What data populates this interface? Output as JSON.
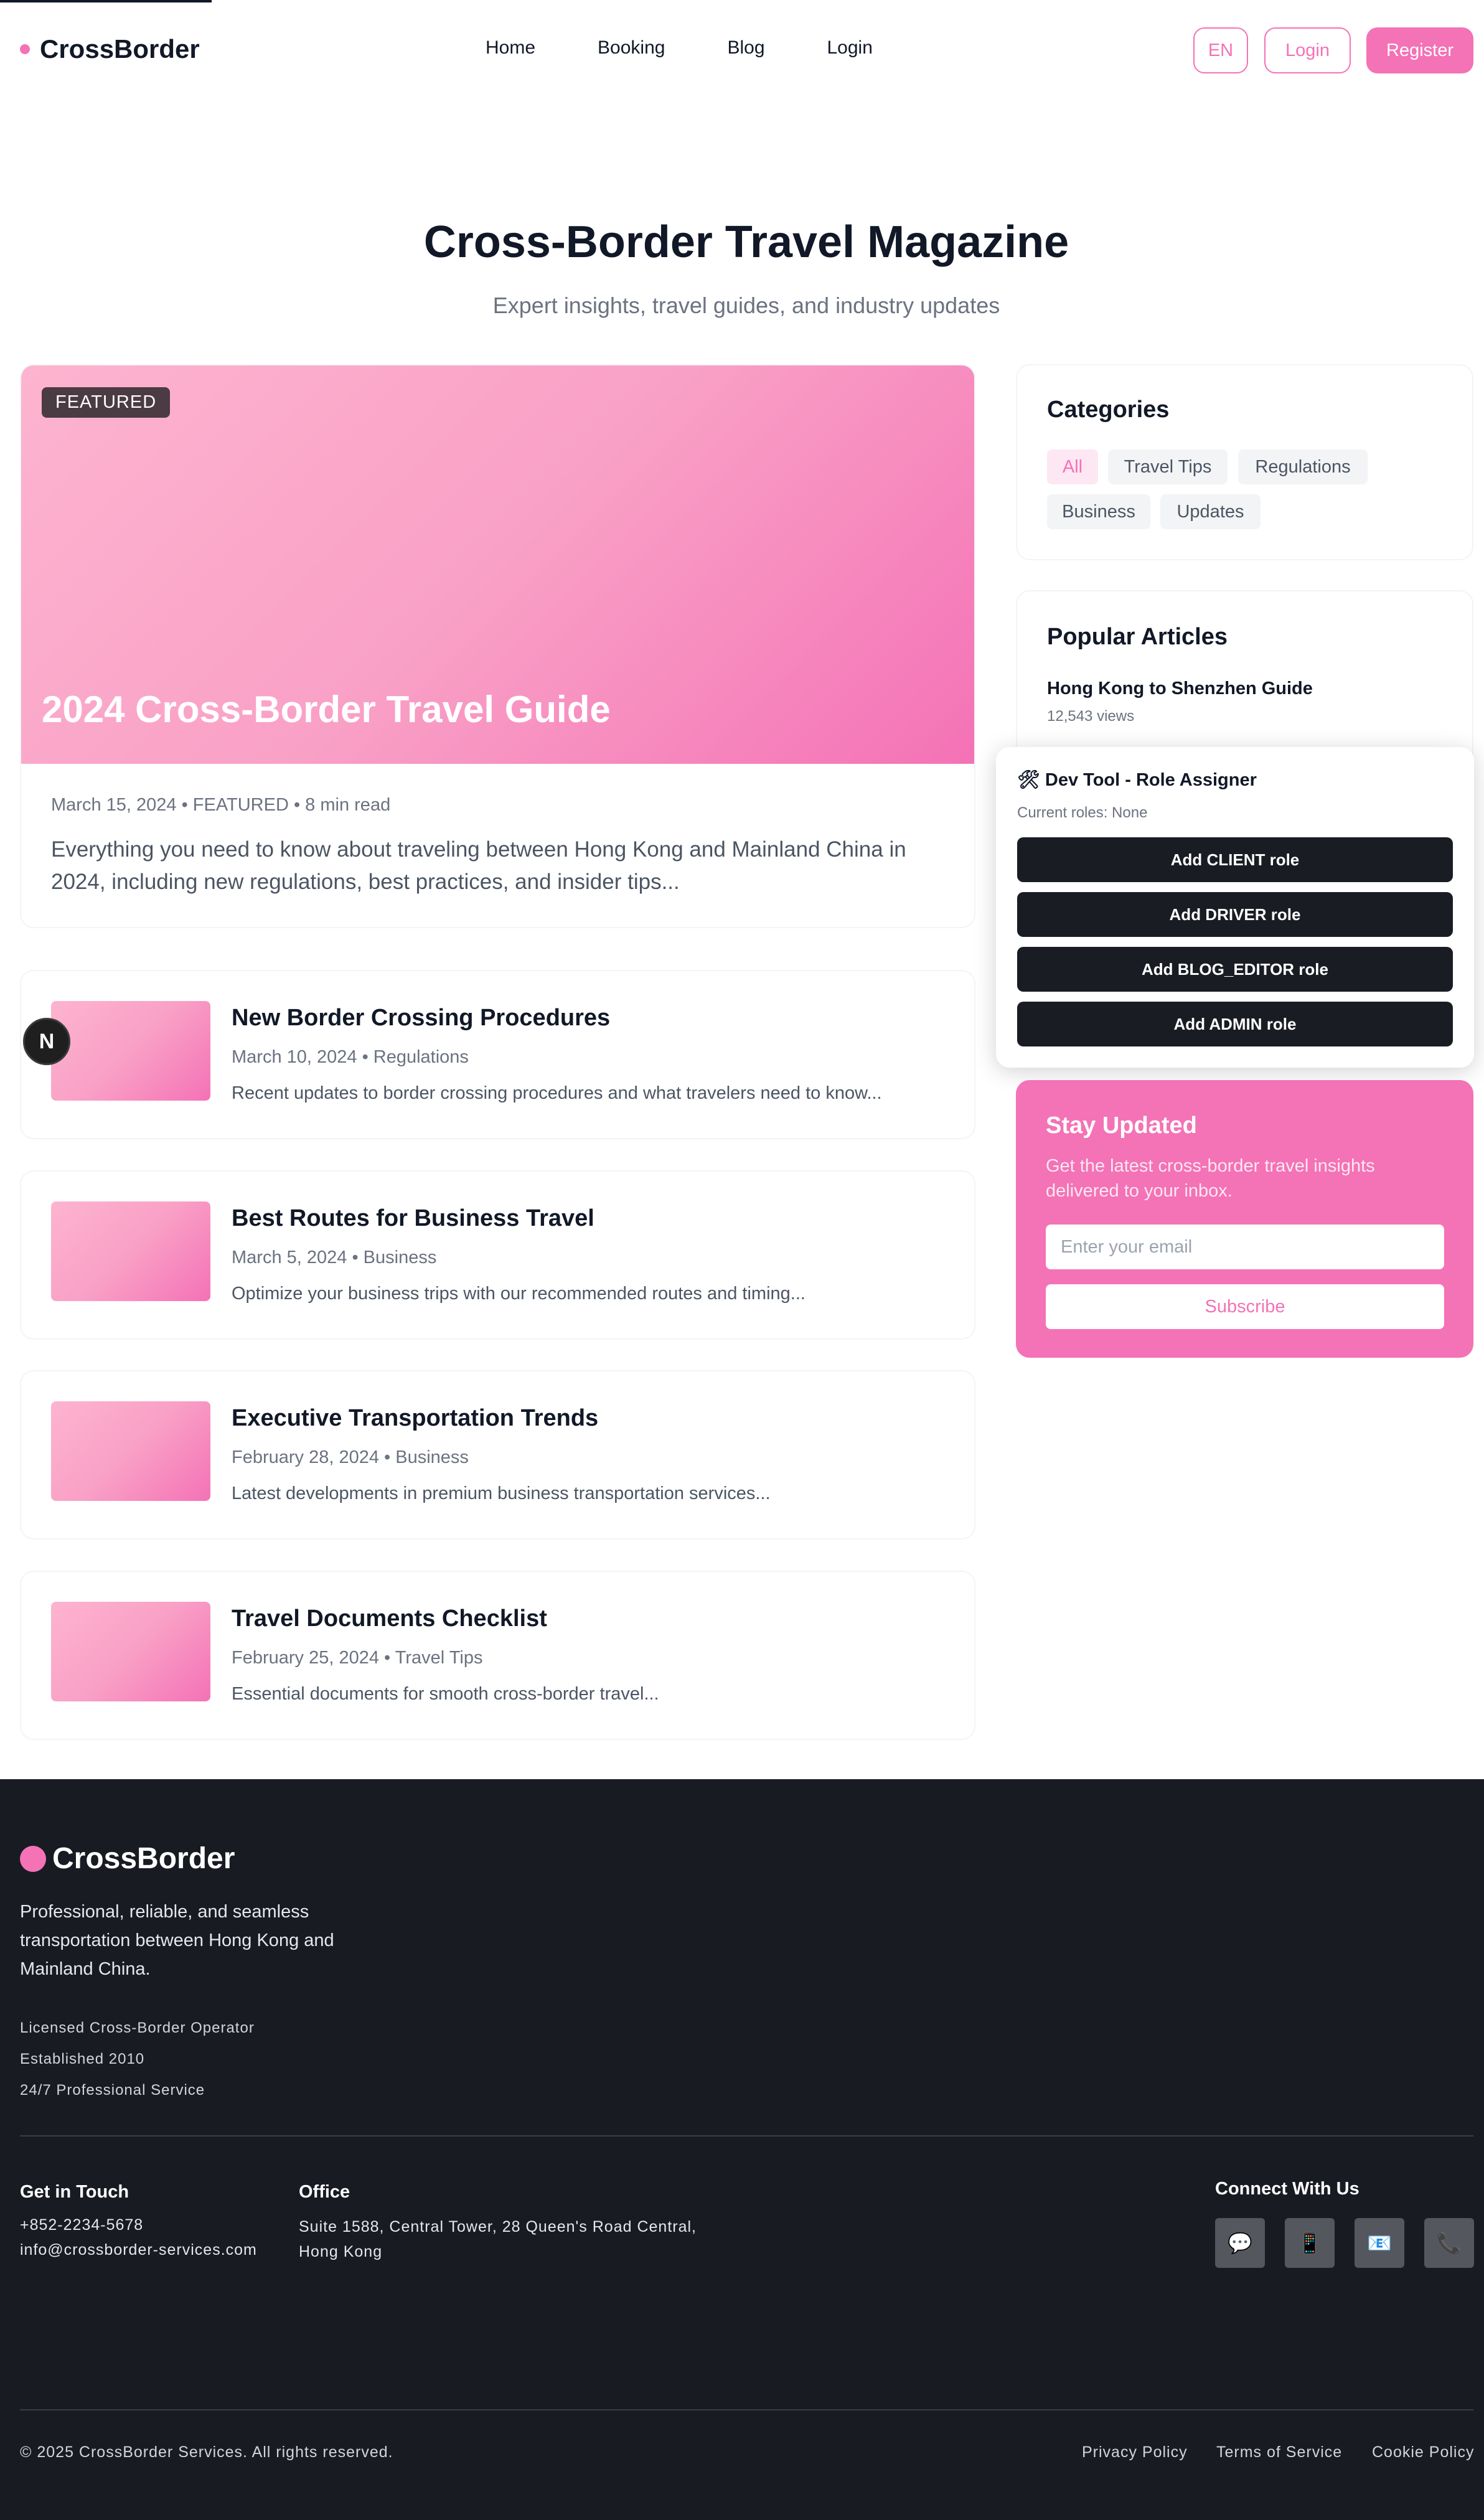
{
  "header": {
    "brand": "CrossBorder",
    "nav": [
      "Home",
      "Booking",
      "Blog",
      "Login"
    ],
    "lang": "EN",
    "login": "Login",
    "register": "Register"
  },
  "hero": {
    "title": "Cross-Border Travel Magazine",
    "subtitle": "Expert insights, travel guides, and industry updates"
  },
  "featured": {
    "badge": "FEATURED",
    "title": "2024 Cross-Border Travel Guide",
    "meta": "March 15, 2024 • FEATURED • 8 min read",
    "excerpt": "Everything you need to know about traveling between Hong Kong and Mainland China in 2024, including new regulations, best practices, and insider tips..."
  },
  "articles": [
    {
      "title": "New Border Crossing Procedures",
      "meta": "March 10, 2024 • Regulations",
      "excerpt": "Recent updates to border crossing procedures and what travelers need to know..."
    },
    {
      "title": "Best Routes for Business Travel",
      "meta": "March 5, 2024 • Business",
      "excerpt": "Optimize your business trips with our recommended routes and timing..."
    },
    {
      "title": "Executive Transportation Trends",
      "meta": "February 28, 2024 • Business",
      "excerpt": "Latest developments in premium business transportation services..."
    },
    {
      "title": "Travel Documents Checklist",
      "meta": "February 25, 2024 • Travel Tips",
      "excerpt": "Essential documents for smooth cross-border travel..."
    }
  ],
  "nextjs_badge": "N",
  "categories": {
    "title": "Categories",
    "items": [
      "All",
      "Travel Tips",
      "Regulations",
      "Business",
      "Updates"
    ],
    "active": "All"
  },
  "popular": {
    "title": "Popular Articles",
    "items": [
      {
        "title": "Hong Kong to Shenzhen Guide",
        "views": "12,543 views"
      }
    ]
  },
  "devtool": {
    "title": "🛠 Dev Tool - Role Assigner",
    "roles": "Current roles: None",
    "buttons": [
      "Add CLIENT role",
      "Add DRIVER role",
      "Add BLOG_EDITOR role",
      "Add ADMIN role"
    ]
  },
  "newsletter": {
    "title": "Stay Updated",
    "text": "Get the latest cross-border travel insights delivered to your inbox.",
    "placeholder": "Enter your email",
    "button": "Subscribe"
  },
  "footer": {
    "brand": "CrossBorder",
    "description": "Professional, reliable, and seamless transportation between Hong Kong and Mainland China.",
    "facts": [
      "Licensed Cross-Border Operator",
      "Established 2010",
      "24/7 Professional Service"
    ],
    "contact_title": "Get in Touch",
    "phone": "+852-2234-5678",
    "email": "info@crossborder-services.com",
    "office_title": "Office",
    "office_line1": "Suite 1588, Central Tower, 28 Queen's Road Central,",
    "office_line2": "Hong Kong",
    "connect_title": "Connect With Us",
    "social_icons": [
      "💬",
      "📱",
      "📧",
      "📞"
    ],
    "copyright": "© 2025 CrossBorder Services. All rights reserved.",
    "links": [
      "Privacy Policy",
      "Terms of Service",
      "Cookie Policy"
    ]
  },
  "colors": {
    "accent": "#f472b6",
    "dark": "#191b23",
    "button_dark": "#1a1c24"
  }
}
